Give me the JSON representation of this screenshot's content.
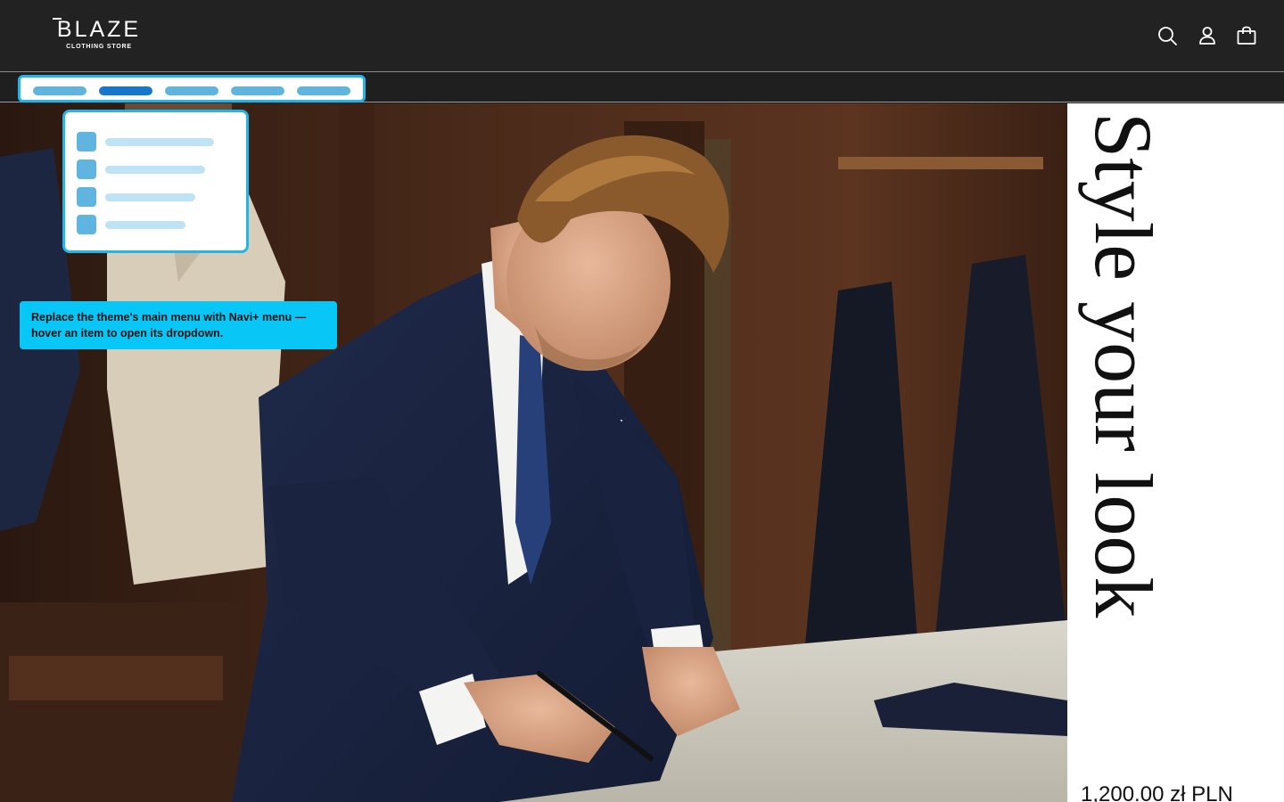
{
  "header": {
    "logo_word": "BLAZE",
    "logo_sub": "CLOTHING STORE",
    "icons": [
      "search-icon",
      "account-icon",
      "cart-icon"
    ]
  },
  "navi_plus": {
    "menu_items": 5,
    "active_index": 1,
    "dropdown_items": 4,
    "accent_color": "#22b6e8",
    "tooltip": "Replace the theme's main menu with Navi+ menu — hover an item to open its dropdown."
  },
  "hero": {
    "image": "man in navy suit tailoring at a workshop table"
  },
  "product": {
    "title": "Style your look",
    "price": "1,200.00 zł PLN"
  },
  "colors": {
    "header_bg": "#222222",
    "accent": "#22b6e8",
    "tooltip_bg": "#08c6f5"
  }
}
